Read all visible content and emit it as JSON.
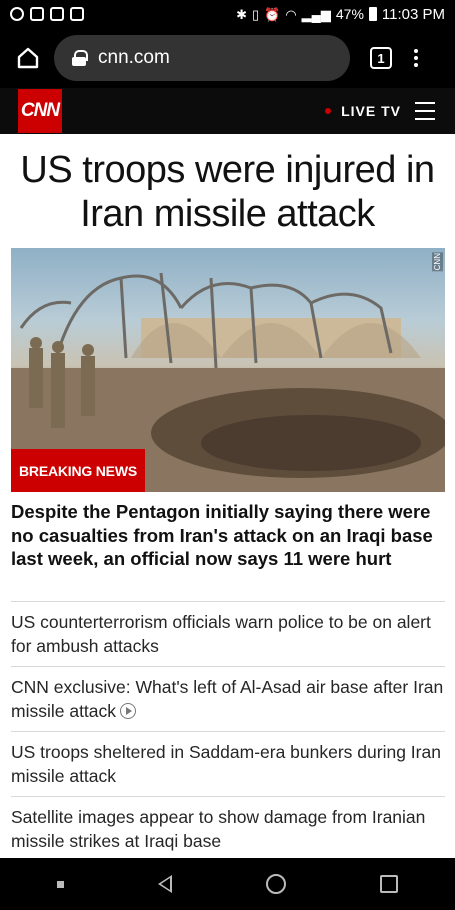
{
  "status_bar": {
    "battery": "47%",
    "time": "11:03 PM"
  },
  "browser": {
    "url": "cnn.com",
    "tab_count": "1"
  },
  "site_header": {
    "logo": "CNN",
    "live_tv": "LIVE TV",
    "brand_color": "#cc0000"
  },
  "article": {
    "headline": "US troops were injured in Iran missile attack",
    "badge": "BREAKING NEWS",
    "image_watermark": "CNN",
    "lead": "Despite the Pentagon initially saying there were no casualties from Iran's attack on an Iraqi base last week, an official now says 11 were hurt"
  },
  "stories": [
    {
      "text": "US counterterrorism officials warn police to be on alert for ambush attacks"
    },
    {
      "text": "CNN exclusive: What's left of Al-Asad air base after Iran missile attack"
    },
    {
      "text": "US troops sheltered in Saddam-era bunkers during Iran missile attack"
    },
    {
      "text": "Satellite images appear to show damage from Iranian missile strikes at Iraqi base"
    }
  ]
}
